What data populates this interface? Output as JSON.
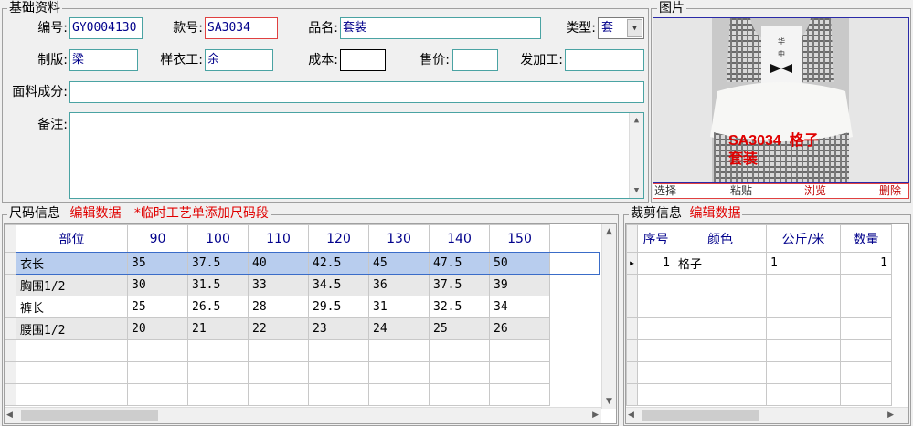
{
  "basic": {
    "legend": "基础资料",
    "code_label": "编号:",
    "code_value": "GY0004130",
    "style_label": "款号:",
    "style_value": "SA3034",
    "product_label": "品名:",
    "product_value": "套装",
    "type_label": "类型:",
    "type_value": "套",
    "pattern_label": "制版:",
    "pattern_value": "梁",
    "sample_label": "样衣工:",
    "sample_value": "余",
    "cost_label": "成本:",
    "cost_value": "",
    "price_label": "售价:",
    "price_value": "",
    "process_label": "发加工:",
    "process_value": "",
    "fabric_label": "面料成分:",
    "fabric_value": "",
    "remark_label": "备注:",
    "remark_value": ""
  },
  "picture": {
    "legend": "图片",
    "caption_line1": "SA3034  格子",
    "caption_line2": "套装",
    "buttons": [
      "选择",
      "粘贴",
      "浏览",
      "删除"
    ]
  },
  "size": {
    "legend": "尺码信息",
    "edit_link": "编辑数据",
    "note": "*临时工艺单添加尺码段",
    "columns": [
      "部位",
      "90",
      "100",
      "110",
      "120",
      "130",
      "140",
      "150"
    ],
    "rows": [
      [
        "衣长",
        "35",
        "37.5",
        "40",
        "42.5",
        "45",
        "47.5",
        "50"
      ],
      [
        "胸围1/2",
        "30",
        "31.5",
        "33",
        "34.5",
        "36",
        "37.5",
        "39"
      ],
      [
        "裤长",
        "25",
        "26.5",
        "28",
        "29.5",
        "31",
        "32.5",
        "34"
      ],
      [
        "腰围1/2",
        "20",
        "21",
        "22",
        "23",
        "24",
        "25",
        "26"
      ]
    ]
  },
  "cut": {
    "legend": "裁剪信息",
    "edit_link": "编辑数据",
    "columns": [
      "序号",
      "颜色",
      "公斤/米",
      "数量"
    ],
    "rows": [
      [
        "1",
        "格子",
        "1",
        "1"
      ]
    ]
  },
  "colors": {
    "accent_red": "#e00000",
    "input_border": "#4aa3a3",
    "selected_row": "#b8cdee",
    "header_text": "#00008b"
  }
}
